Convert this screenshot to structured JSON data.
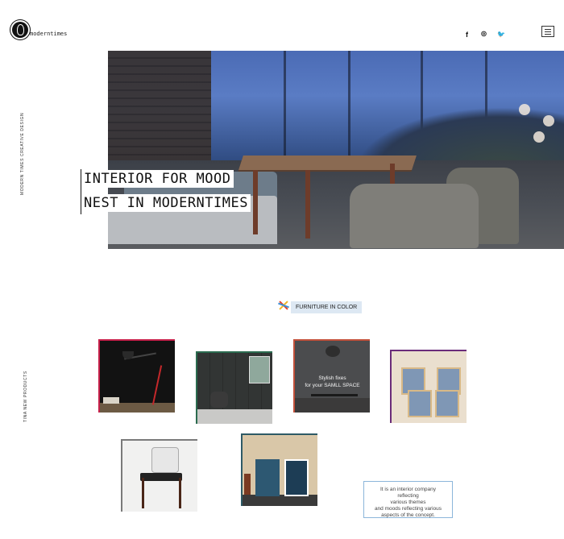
{
  "brand": {
    "logo_text": "moderntimes"
  },
  "header": {
    "social": {
      "facebook": "f",
      "instagram": "◎",
      "twitter": "🐦"
    }
  },
  "hero": {
    "title_line1": "INTERIOR FOR MOOD",
    "title_line2": "NEST IN MODERNTIMES",
    "side_label": "MODERN TIMES CREATIVE DESIGN"
  },
  "section": {
    "tag_label": "FURNITURE IN COLOR",
    "side_label": "TINA NEW PRODUCTS"
  },
  "products": {
    "card3_text_line1": "Stylish fixes",
    "card3_text_line2": "for your SAMLL SPACE"
  },
  "info_box": {
    "line1": "It is an interior company",
    "line2": "reflecting",
    "line3": "various themes",
    "line4": "and moods reflecting various",
    "line5": "aspects of the concept."
  },
  "colors": {
    "card1_accent": "#c7204a",
    "card2_accent": "#2b6b4f",
    "card3_accent": "#c2503a",
    "card4_accent": "#6a2c7a",
    "tag_bg": "#dde8f3",
    "info_border": "#8cb6da"
  }
}
